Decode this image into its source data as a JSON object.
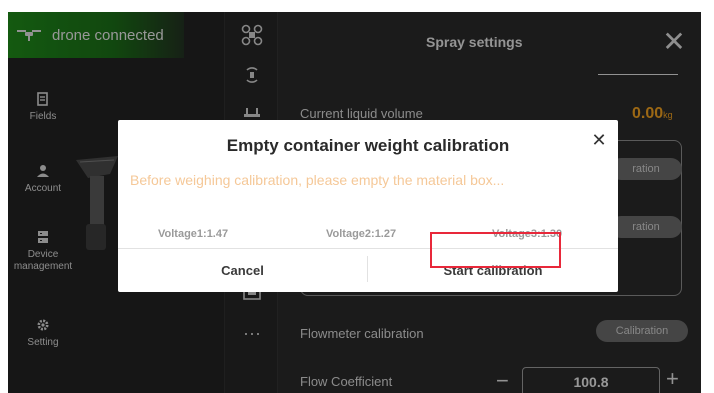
{
  "status": {
    "text": "drone connected",
    "icon": "drone-icon",
    "color": "#1f8a1a"
  },
  "sidebar": {
    "items": [
      {
        "label": "Fields",
        "icon": "fields-icon"
      },
      {
        "label": "Account",
        "icon": "account-icon"
      },
      {
        "label": "Device management",
        "icon": "device-icon"
      },
      {
        "label": "Setting",
        "icon": "gear-icon"
      }
    ]
  },
  "icon_strip": [
    "drone-icon",
    "signal-icon",
    "spray-icon",
    "box-icon",
    "more-icon"
  ],
  "icon_strip_more": "···",
  "spray": {
    "title": "Spray settings",
    "close": "✕",
    "liquid_label": "Current liquid volume",
    "liquid_value": "0.00",
    "liquid_unit": "kg",
    "pill_1": "ration",
    "pill_2": "ration",
    "flowmeter_label": "Flowmeter calibration",
    "flowmeter_button": "Calibration",
    "flow_label": "Flow Coefficient",
    "flow_value": "100.8",
    "minus": "−",
    "plus": "+"
  },
  "modal": {
    "title": "Empty container weight calibration",
    "close": "✕",
    "message": "Before weighing calibration, please empty the material box...",
    "voltage1": "Voltage1:1.47",
    "voltage2": "Voltage2:1.27",
    "voltage3": "Voltage3:1.30",
    "cancel": "Cancel",
    "start": "Start calibration"
  },
  "colors": {
    "accent": "#f0a020",
    "highlight": "#e8283a",
    "message": "#f5c898"
  }
}
